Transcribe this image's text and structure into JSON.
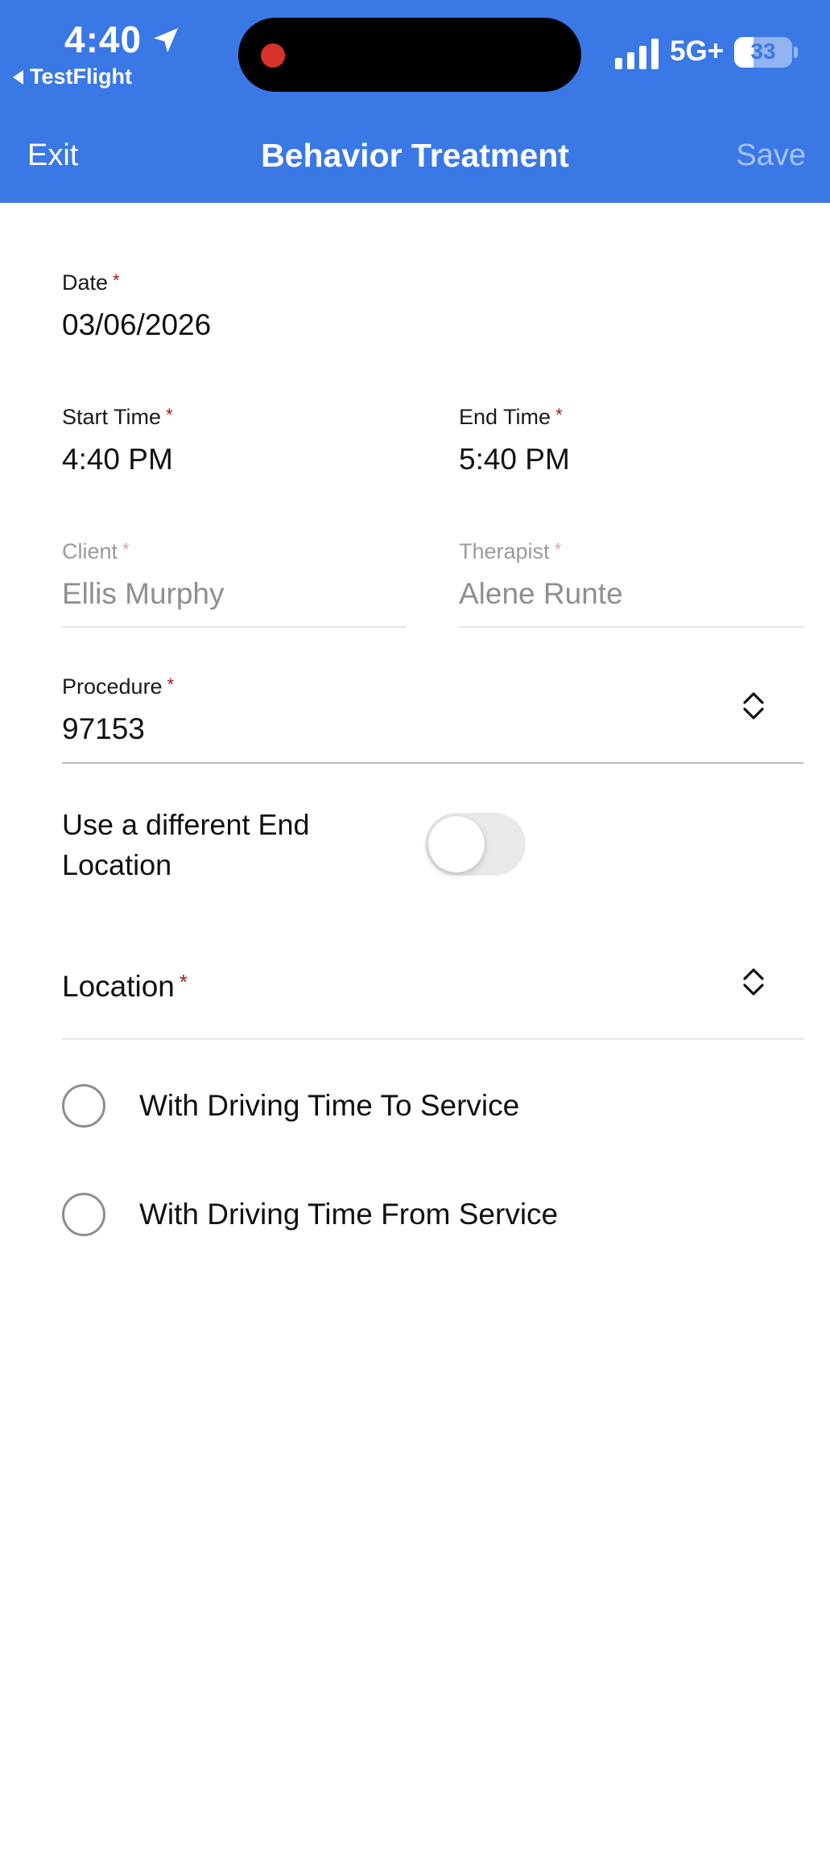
{
  "status_bar": {
    "time": "4:40",
    "back_app": "TestFlight",
    "network": "5G+",
    "battery": "33",
    "battery_level": 0.33,
    "recording_indicator_color": "#d6332b"
  },
  "nav": {
    "exit_label": "Exit",
    "title": "Behavior Treatment",
    "save_label": "Save",
    "background_color": "#3a78e6"
  },
  "form": {
    "date": {
      "label": "Date",
      "required_mark": "*",
      "value": "03/06/2026"
    },
    "start_time": {
      "label": "Start Time",
      "required_mark": "*",
      "value": "4:40 PM"
    },
    "end_time": {
      "label": "End Time",
      "required_mark": "*",
      "value": "5:40 PM"
    },
    "client": {
      "label": "Client",
      "required_mark": "*",
      "value": "Ellis Murphy"
    },
    "therapist": {
      "label": "Therapist",
      "required_mark": "*",
      "value": "Alene Runte"
    },
    "procedure": {
      "label": "Procedure",
      "required_mark": "*",
      "value": "97153"
    },
    "different_end_location": {
      "label": "Use a different End Location",
      "enabled": false
    },
    "location": {
      "label": "Location",
      "required_mark": "*"
    },
    "options": [
      {
        "label": "With Driving Time To Service",
        "selected": false
      },
      {
        "label": "With Driving Time From Service",
        "selected": false
      }
    ]
  },
  "icons": {
    "location_arrow": "location-arrow-icon",
    "signal": "cellular-signal-icon",
    "back_caret": "back-triangle-icon",
    "select_chevron": "chevron-up-down-icon"
  }
}
